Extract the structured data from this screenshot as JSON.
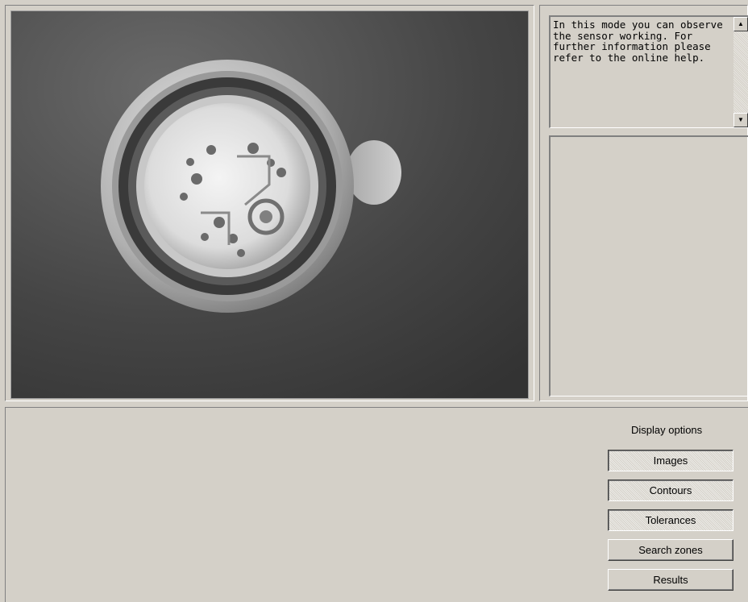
{
  "info": {
    "text": "In this mode you can observe the sensor working. For further information please refer to the online help."
  },
  "display_options": {
    "title": "Display options",
    "buttons": [
      {
        "label": "Images",
        "pressed": true
      },
      {
        "label": "Contours",
        "pressed": true
      },
      {
        "label": "Tolerances",
        "pressed": true
      },
      {
        "label": "Search zones",
        "pressed": false
      },
      {
        "label": "Results",
        "pressed": false
      }
    ]
  },
  "icons": {
    "scroll_up": "scroll-up-arrow-icon",
    "scroll_down": "scroll-down-arrow-icon"
  },
  "colors": {
    "window_bg": "#d4d0c8",
    "camera_bg": "#3e3e3e"
  }
}
